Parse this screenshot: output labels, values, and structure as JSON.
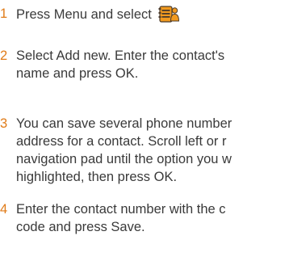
{
  "steps": [
    {
      "number": "1",
      "lines": [
        "Press Menu and select"
      ],
      "icon": "contacts-icon"
    },
    {
      "number": "2",
      "lines": [
        "Select Add new. Enter the contact's",
        "name and press OK."
      ]
    },
    {
      "number": "3",
      "lines": [
        "You can save several phone number",
        "address for a contact. Scroll left or r",
        "navigation pad until the option you w",
        "highlighted, then press OK."
      ]
    },
    {
      "number": "4",
      "lines": [
        "Enter the contact number with the c",
        "code and press Save."
      ]
    }
  ],
  "colors": {
    "step_number": "#e07b18",
    "body_text": "#3a3a3a",
    "icon_orange": "#f29a1f",
    "icon_dark": "#4a3a2a"
  }
}
